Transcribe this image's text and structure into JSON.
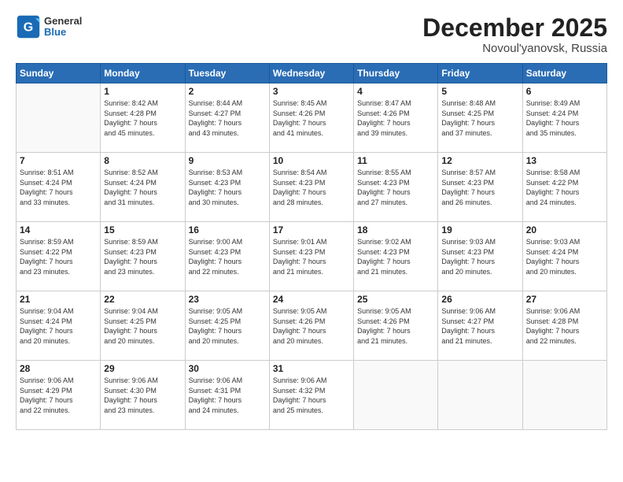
{
  "header": {
    "logo_line1": "General",
    "logo_line2": "Blue",
    "month_title": "December 2025",
    "location": "Novoul'yanovsk, Russia"
  },
  "weekdays": [
    "Sunday",
    "Monday",
    "Tuesday",
    "Wednesday",
    "Thursday",
    "Friday",
    "Saturday"
  ],
  "weeks": [
    [
      {
        "day": "",
        "info": ""
      },
      {
        "day": "1",
        "info": "Sunrise: 8:42 AM\nSunset: 4:28 PM\nDaylight: 7 hours\nand 45 minutes."
      },
      {
        "day": "2",
        "info": "Sunrise: 8:44 AM\nSunset: 4:27 PM\nDaylight: 7 hours\nand 43 minutes."
      },
      {
        "day": "3",
        "info": "Sunrise: 8:45 AM\nSunset: 4:26 PM\nDaylight: 7 hours\nand 41 minutes."
      },
      {
        "day": "4",
        "info": "Sunrise: 8:47 AM\nSunset: 4:26 PM\nDaylight: 7 hours\nand 39 minutes."
      },
      {
        "day": "5",
        "info": "Sunrise: 8:48 AM\nSunset: 4:25 PM\nDaylight: 7 hours\nand 37 minutes."
      },
      {
        "day": "6",
        "info": "Sunrise: 8:49 AM\nSunset: 4:24 PM\nDaylight: 7 hours\nand 35 minutes."
      }
    ],
    [
      {
        "day": "7",
        "info": "Sunrise: 8:51 AM\nSunset: 4:24 PM\nDaylight: 7 hours\nand 33 minutes."
      },
      {
        "day": "8",
        "info": "Sunrise: 8:52 AM\nSunset: 4:24 PM\nDaylight: 7 hours\nand 31 minutes."
      },
      {
        "day": "9",
        "info": "Sunrise: 8:53 AM\nSunset: 4:23 PM\nDaylight: 7 hours\nand 30 minutes."
      },
      {
        "day": "10",
        "info": "Sunrise: 8:54 AM\nSunset: 4:23 PM\nDaylight: 7 hours\nand 28 minutes."
      },
      {
        "day": "11",
        "info": "Sunrise: 8:55 AM\nSunset: 4:23 PM\nDaylight: 7 hours\nand 27 minutes."
      },
      {
        "day": "12",
        "info": "Sunrise: 8:57 AM\nSunset: 4:23 PM\nDaylight: 7 hours\nand 26 minutes."
      },
      {
        "day": "13",
        "info": "Sunrise: 8:58 AM\nSunset: 4:22 PM\nDaylight: 7 hours\nand 24 minutes."
      }
    ],
    [
      {
        "day": "14",
        "info": "Sunrise: 8:59 AM\nSunset: 4:22 PM\nDaylight: 7 hours\nand 23 minutes."
      },
      {
        "day": "15",
        "info": "Sunrise: 8:59 AM\nSunset: 4:23 PM\nDaylight: 7 hours\nand 23 minutes."
      },
      {
        "day": "16",
        "info": "Sunrise: 9:00 AM\nSunset: 4:23 PM\nDaylight: 7 hours\nand 22 minutes."
      },
      {
        "day": "17",
        "info": "Sunrise: 9:01 AM\nSunset: 4:23 PM\nDaylight: 7 hours\nand 21 minutes."
      },
      {
        "day": "18",
        "info": "Sunrise: 9:02 AM\nSunset: 4:23 PM\nDaylight: 7 hours\nand 21 minutes."
      },
      {
        "day": "19",
        "info": "Sunrise: 9:03 AM\nSunset: 4:23 PM\nDaylight: 7 hours\nand 20 minutes."
      },
      {
        "day": "20",
        "info": "Sunrise: 9:03 AM\nSunset: 4:24 PM\nDaylight: 7 hours\nand 20 minutes."
      }
    ],
    [
      {
        "day": "21",
        "info": "Sunrise: 9:04 AM\nSunset: 4:24 PM\nDaylight: 7 hours\nand 20 minutes."
      },
      {
        "day": "22",
        "info": "Sunrise: 9:04 AM\nSunset: 4:25 PM\nDaylight: 7 hours\nand 20 minutes."
      },
      {
        "day": "23",
        "info": "Sunrise: 9:05 AM\nSunset: 4:25 PM\nDaylight: 7 hours\nand 20 minutes."
      },
      {
        "day": "24",
        "info": "Sunrise: 9:05 AM\nSunset: 4:26 PM\nDaylight: 7 hours\nand 20 minutes."
      },
      {
        "day": "25",
        "info": "Sunrise: 9:05 AM\nSunset: 4:26 PM\nDaylight: 7 hours\nand 21 minutes."
      },
      {
        "day": "26",
        "info": "Sunrise: 9:06 AM\nSunset: 4:27 PM\nDaylight: 7 hours\nand 21 minutes."
      },
      {
        "day": "27",
        "info": "Sunrise: 9:06 AM\nSunset: 4:28 PM\nDaylight: 7 hours\nand 22 minutes."
      }
    ],
    [
      {
        "day": "28",
        "info": "Sunrise: 9:06 AM\nSunset: 4:29 PM\nDaylight: 7 hours\nand 22 minutes."
      },
      {
        "day": "29",
        "info": "Sunrise: 9:06 AM\nSunset: 4:30 PM\nDaylight: 7 hours\nand 23 minutes."
      },
      {
        "day": "30",
        "info": "Sunrise: 9:06 AM\nSunset: 4:31 PM\nDaylight: 7 hours\nand 24 minutes."
      },
      {
        "day": "31",
        "info": "Sunrise: 9:06 AM\nSunset: 4:32 PM\nDaylight: 7 hours\nand 25 minutes."
      },
      {
        "day": "",
        "info": ""
      },
      {
        "day": "",
        "info": ""
      },
      {
        "day": "",
        "info": ""
      }
    ]
  ]
}
